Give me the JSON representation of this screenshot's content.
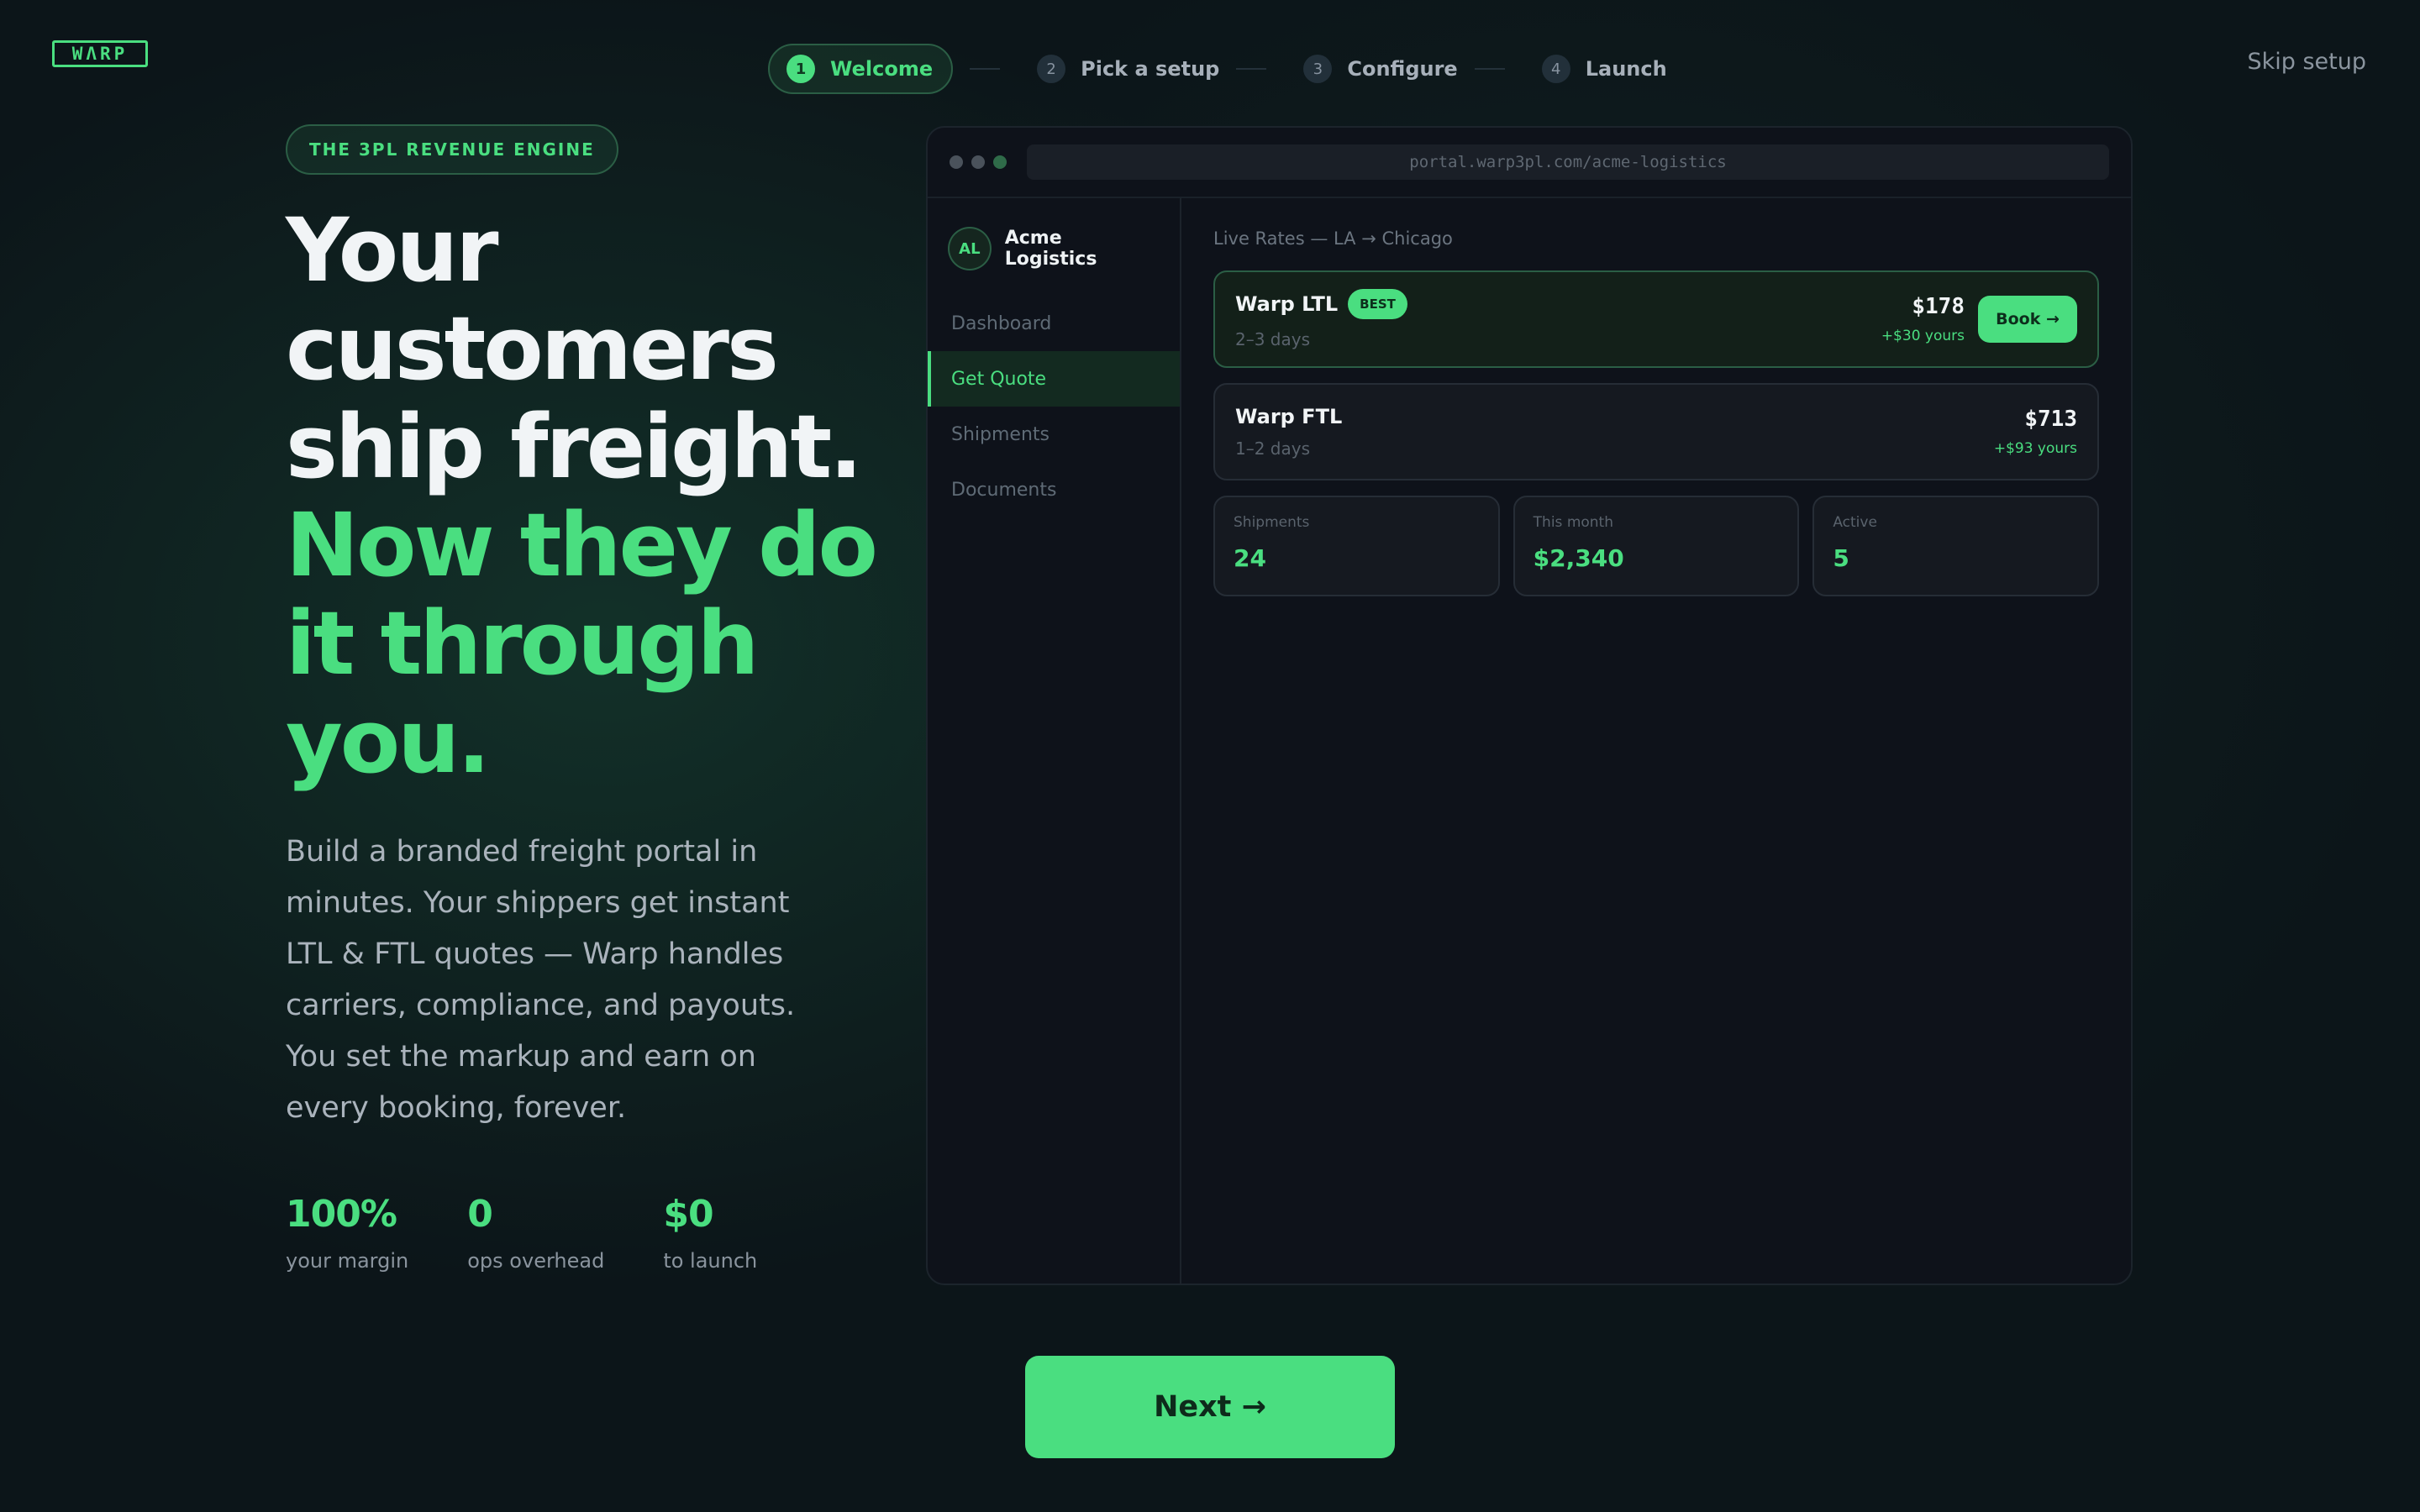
{
  "brand": {
    "logo_text": "WΛRP",
    "accent": "#4ade80"
  },
  "stepper": {
    "steps": [
      {
        "num": "1",
        "label": "Welcome",
        "active": true
      },
      {
        "num": "2",
        "label": "Pick a setup",
        "active": false
      },
      {
        "num": "3",
        "label": "Configure",
        "active": false
      },
      {
        "num": "4",
        "label": "Launch",
        "active": false
      }
    ],
    "skip_label": "Skip setup"
  },
  "hero": {
    "eyebrow": "THE 3PL REVENUE ENGINE",
    "headline_white": [
      "Your",
      "customers",
      "ship freight."
    ],
    "headline_green": [
      "Now they do",
      "it through",
      "you."
    ],
    "subtext": "Build a branded freight portal in minutes. Your shippers get instant LTL & FTL quotes — Warp handles carriers, compliance, and payouts. You set the markup and earn on every booking, forever.",
    "stats": [
      {
        "value": "100%",
        "label": "your margin"
      },
      {
        "value": "0",
        "label": "ops overhead"
      },
      {
        "value": "$0",
        "label": "to launch"
      }
    ]
  },
  "preview": {
    "url": "portal.warp3pl.com/acme-logistics",
    "org": {
      "initials": "AL",
      "name": "Acme Logistics"
    },
    "nav": [
      {
        "label": "Dashboard",
        "active": false
      },
      {
        "label": "Get Quote",
        "active": true
      },
      {
        "label": "Shipments",
        "active": false
      },
      {
        "label": "Documents",
        "active": false
      }
    ],
    "route_label": "Live Rates — LA → Chicago",
    "rates": [
      {
        "name": "Warp LTL",
        "badge": "BEST",
        "days": "2–3 days",
        "price": "$178",
        "yours": "+$30 yours",
        "action": "Book →"
      },
      {
        "name": "Warp FTL",
        "days": "1–2 days",
        "price": "$713",
        "yours": "+$93 yours"
      }
    ],
    "metrics": [
      {
        "label": "Shipments",
        "value": "24"
      },
      {
        "label": "This month",
        "value": "$2,340"
      },
      {
        "label": "Active",
        "value": "5"
      }
    ]
  },
  "footer": {
    "next_label": "Next →"
  }
}
